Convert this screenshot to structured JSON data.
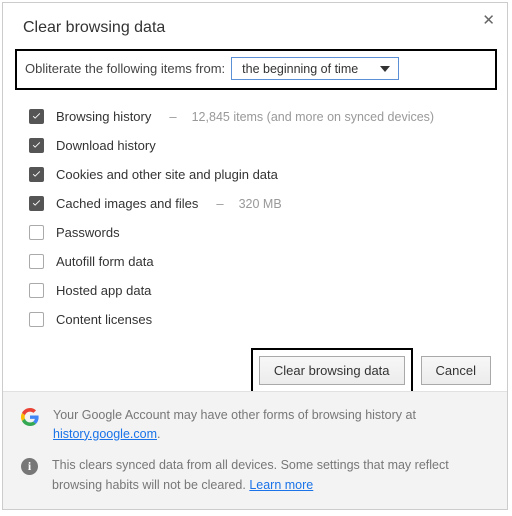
{
  "title": "Clear browsing data",
  "prompt": "Obliterate the following items from:",
  "range_selected": "the beginning of time",
  "items": [
    {
      "label": "Browsing history",
      "checked": true,
      "hint": "12,845 items (and more on synced devices)"
    },
    {
      "label": "Download history",
      "checked": true,
      "hint": ""
    },
    {
      "label": "Cookies and other site and plugin data",
      "checked": true,
      "hint": ""
    },
    {
      "label": "Cached images and files",
      "checked": true,
      "hint": "320 MB"
    },
    {
      "label": "Passwords",
      "checked": false,
      "hint": ""
    },
    {
      "label": "Autofill form data",
      "checked": false,
      "hint": ""
    },
    {
      "label": "Hosted app data",
      "checked": false,
      "hint": ""
    },
    {
      "label": "Content licenses",
      "checked": false,
      "hint": ""
    }
  ],
  "buttons": {
    "clear": "Clear browsing data",
    "cancel": "Cancel"
  },
  "footer": {
    "g_line_a": "Your Google Account may have other forms of browsing history at ",
    "g_link": "history.google.com",
    "g_line_b": ".",
    "info_line_a": "This clears synced data from all devices. Some settings that may reflect browsing habits will not be cleared. ",
    "learn_more": "Learn more"
  }
}
